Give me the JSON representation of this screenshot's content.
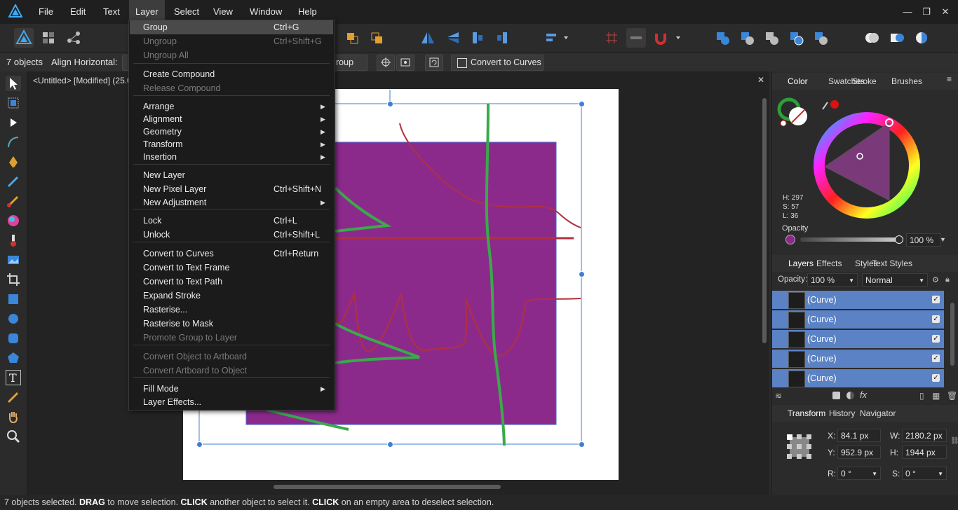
{
  "app": {
    "name": "Affinity Designer"
  },
  "menubar": {
    "items": [
      "File",
      "Edit",
      "Text",
      "Layer",
      "Select",
      "View",
      "Window",
      "Help"
    ],
    "active": "Layer"
  },
  "window_controls": {
    "minimize": "—",
    "restore": "❐",
    "close": "✕"
  },
  "context": {
    "objects": "7 objects",
    "align_label": "Align Horizontal:",
    "group_btn": "roup",
    "convert_btn": "Convert to Curves"
  },
  "document": {
    "tab": "<Untitled> [Modified] (25.0%"
  },
  "layer_menu": [
    {
      "label": "Group",
      "shortcut": "Ctrl+G",
      "enabled": true,
      "highlight": true
    },
    {
      "label": "Ungroup",
      "shortcut": "Ctrl+Shift+G",
      "enabled": false
    },
    {
      "label": "Ungroup All",
      "shortcut": "",
      "enabled": false
    },
    {
      "sep": true
    },
    {
      "label": "Create Compound",
      "shortcut": "",
      "enabled": true
    },
    {
      "label": "Release Compound",
      "shortcut": "",
      "enabled": false
    },
    {
      "sep": true
    },
    {
      "label": "Arrange",
      "submenu": true,
      "enabled": true
    },
    {
      "label": "Alignment",
      "submenu": true,
      "enabled": true
    },
    {
      "label": "Geometry",
      "submenu": true,
      "enabled": true
    },
    {
      "label": "Transform",
      "submenu": true,
      "enabled": true
    },
    {
      "label": "Insertion",
      "submenu": true,
      "enabled": true
    },
    {
      "sep": true
    },
    {
      "label": "New Layer",
      "shortcut": "",
      "enabled": true
    },
    {
      "label": "New Pixel Layer",
      "shortcut": "Ctrl+Shift+N",
      "enabled": true
    },
    {
      "label": "New Adjustment",
      "submenu": true,
      "enabled": true
    },
    {
      "sep": true
    },
    {
      "label": "Lock",
      "shortcut": "Ctrl+L",
      "enabled": true
    },
    {
      "label": "Unlock",
      "shortcut": "Ctrl+Shift+L",
      "enabled": true
    },
    {
      "sep": true
    },
    {
      "label": "Convert to Curves",
      "shortcut": "Ctrl+Return",
      "enabled": true
    },
    {
      "label": "Convert to Text Frame",
      "shortcut": "",
      "enabled": true
    },
    {
      "label": "Convert to Text Path",
      "shortcut": "",
      "enabled": true
    },
    {
      "label": "Expand Stroke",
      "shortcut": "",
      "enabled": true
    },
    {
      "label": "Rasterise...",
      "shortcut": "",
      "enabled": true
    },
    {
      "label": "Rasterise to Mask",
      "shortcut": "",
      "enabled": true
    },
    {
      "label": "Promote Group to Layer",
      "shortcut": "",
      "enabled": false
    },
    {
      "sep": true
    },
    {
      "label": "Convert Object to Artboard",
      "shortcut": "",
      "enabled": false
    },
    {
      "label": "Convert Artboard to Object",
      "shortcut": "",
      "enabled": false
    },
    {
      "sep": true
    },
    {
      "label": "Fill Mode",
      "submenu": true,
      "enabled": true
    },
    {
      "label": "Layer Effects...",
      "shortcut": "",
      "enabled": true
    }
  ],
  "color_panel": {
    "tabs": [
      "Color",
      "Swatches",
      "Stroke",
      "Brushes"
    ],
    "h": "H: 297",
    "s": "S: 57",
    "l": "L: 36",
    "opacity_label": "Opacity",
    "opacity_value": "100 %",
    "fill_color": "#8c2a8c"
  },
  "layers_panel": {
    "tabs": [
      "Layers",
      "Effects",
      "Styles",
      "Text Styles"
    ],
    "opacity_label": "Opacity:",
    "opacity_value": "100 %",
    "blend_mode": "Normal",
    "rows": [
      "(Curve)",
      "(Curve)",
      "(Curve)",
      "(Curve)",
      "(Curve)"
    ]
  },
  "transform_panel": {
    "tabs": [
      "Transform",
      "History",
      "Navigator"
    ],
    "x_label": "X:",
    "x": "84.1 px",
    "y_label": "Y:",
    "y": "952.9 px",
    "w_label": "W:",
    "w": "2180.2 px",
    "h_label": "H:",
    "h": "1944 px",
    "r_label": "R:",
    "r": "0 °",
    "s_label": "S:",
    "s": "0 °"
  },
  "status": {
    "parts": [
      "7 objects selected. ",
      "DRAG",
      " to move selection. ",
      "CLICK",
      " another object to select it. ",
      "CLICK",
      " on an empty area to deselect selection."
    ]
  }
}
